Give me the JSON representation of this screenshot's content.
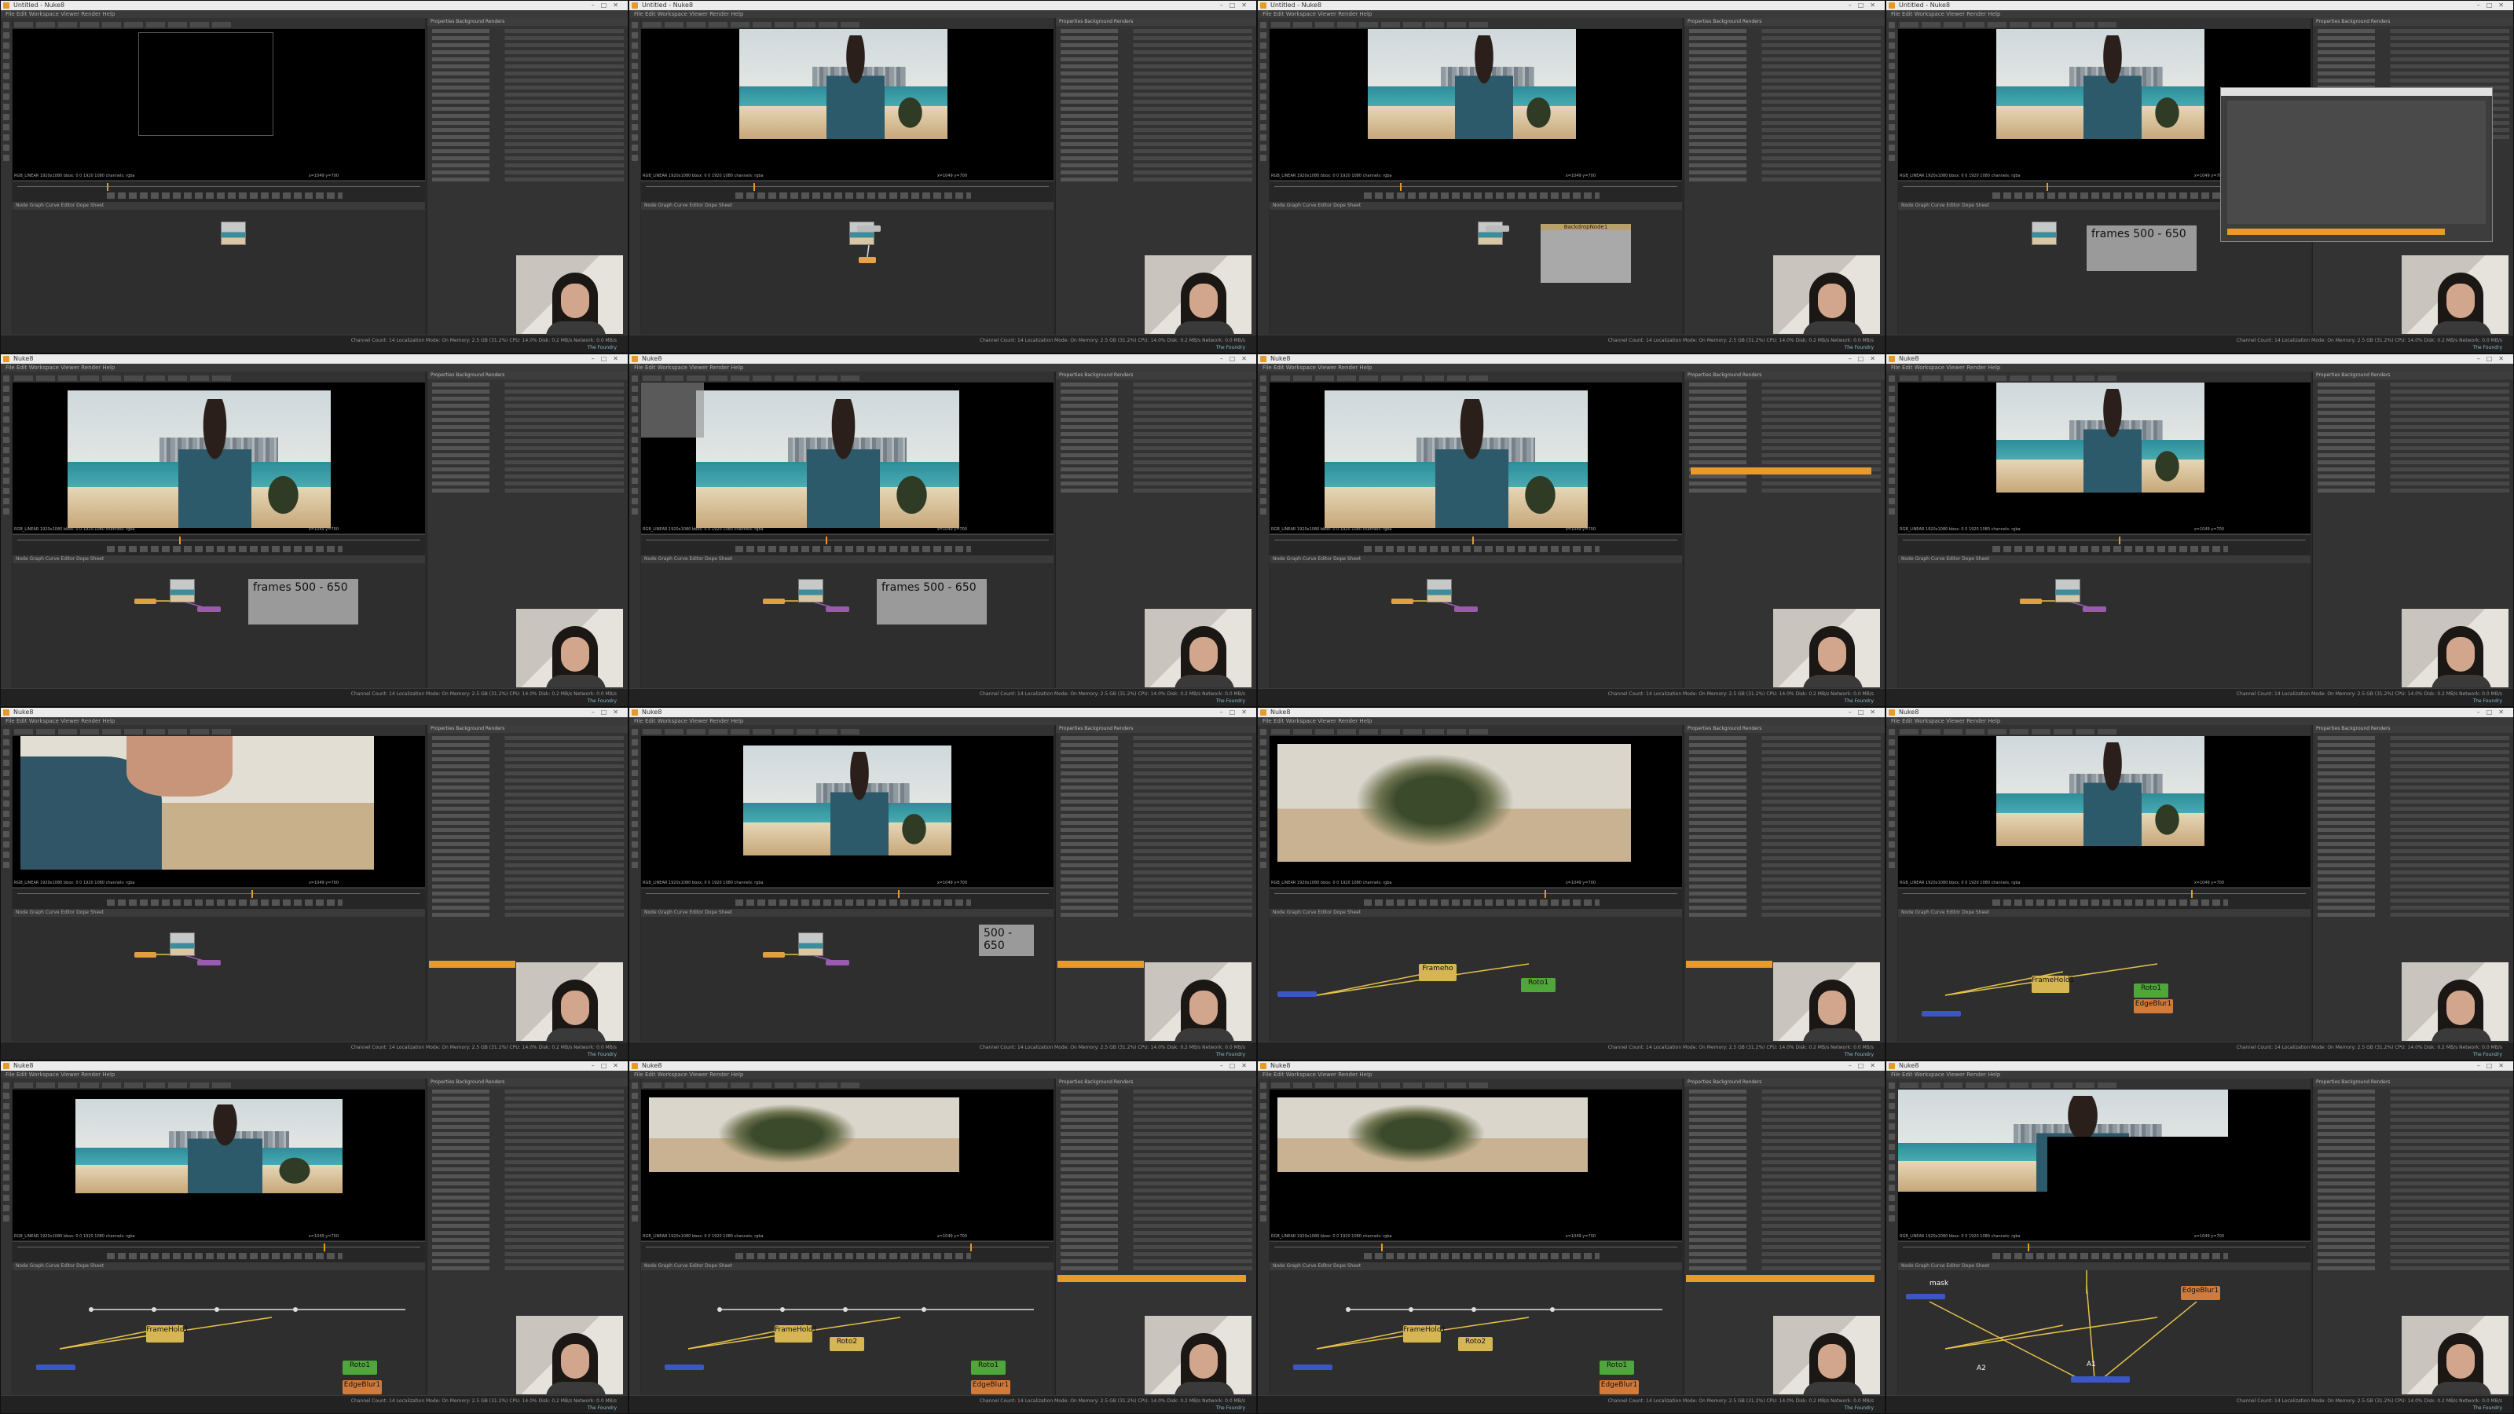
{
  "panes": [
    {
      "title": "Untitled - Nuke8",
      "variant": "empty",
      "sticky": "",
      "labels": []
    },
    {
      "title": "Untitled - Nuke8",
      "variant": "photo",
      "sticky": "",
      "labels": []
    },
    {
      "title": "Untitled - Nuke8",
      "variant": "photo",
      "sticky": "",
      "labels": [
        "BackdropNode1"
      ]
    },
    {
      "title": "Untitled - Nuke8",
      "variant": "dialog",
      "sticky": "frames 500 - 650",
      "labels": []
    },
    {
      "title": "Nuke8",
      "variant": "photo-wide",
      "sticky": "frames 500 - 650",
      "labels": []
    },
    {
      "title": "Nuke8",
      "variant": "photo-wide",
      "sticky": "frames 500 - 650",
      "labels": []
    },
    {
      "title": "Nuke8",
      "variant": "photo-wide",
      "sticky": "",
      "labels": []
    },
    {
      "title": "Nuke8",
      "variant": "photo",
      "sticky": "",
      "labels": []
    },
    {
      "title": "Nuke8",
      "variant": "blur-arm",
      "sticky": "",
      "labels": []
    },
    {
      "title": "Nuke8",
      "variant": "photo-small",
      "sticky": "500 - 650",
      "labels": []
    },
    {
      "title": "Nuke8",
      "variant": "blur-palm",
      "sticky": "",
      "labels": [
        "Frameho",
        "Roto1"
      ]
    },
    {
      "title": "Nuke8",
      "variant": "photo",
      "sticky": "",
      "labels": [
        "FrameHold1",
        "Roto1",
        "EdgeBlur1"
      ]
    },
    {
      "title": "Nuke8",
      "variant": "photo-crop",
      "sticky": "",
      "labels": [
        "FrameHold1",
        "Roto1",
        "EdgeBlur1"
      ]
    },
    {
      "title": "Nuke8",
      "variant": "blur-palm-wide",
      "sticky": "",
      "labels": [
        "Roto2",
        "FrameHold1",
        "Roto1",
        "EdgeBlur1"
      ]
    },
    {
      "title": "Nuke8",
      "variant": "blur-palm-wide",
      "sticky": "",
      "labels": [
        "Roto2",
        "FrameHold1",
        "Roto1",
        "EdgeBlur1"
      ]
    },
    {
      "title": "Nuke8",
      "variant": "photo-mask",
      "sticky": "",
      "labels": [
        "EdgeBlur1",
        "mask",
        "A2",
        "A1"
      ]
    }
  ],
  "common": {
    "menu": "File  Edit  Workspace  Viewer  Render  Help",
    "node_tabs": "Node Graph   Curve Editor   Dope Sheet",
    "props_tabs": "Properties   Background Renders",
    "status": "Channel Count: 14  Localization Mode: On  Memory: 2.5 GB (31.2%)  CPU: 14.0%  Disk: 0.2 MB/s  Network: 0.0 MB/s",
    "brand": "The Foundry",
    "viewer_info_left": "RGB_LINEAR  1920x1080  bbox: 0 0 1920 1080  channels: rgba",
    "viewer_info_right": "x=1049 y=700"
  },
  "icons": [
    "nuke-app-icon",
    "window-controls-icon",
    "webcam-feed"
  ],
  "colors": {
    "accent": "#e59a2c",
    "node_roto": "#4fa63a",
    "node_framehold": "#d6b653",
    "node_edgeblur": "#d27a3a",
    "node_merge": "#3b57c4",
    "sticky": "#9a9a9a"
  }
}
